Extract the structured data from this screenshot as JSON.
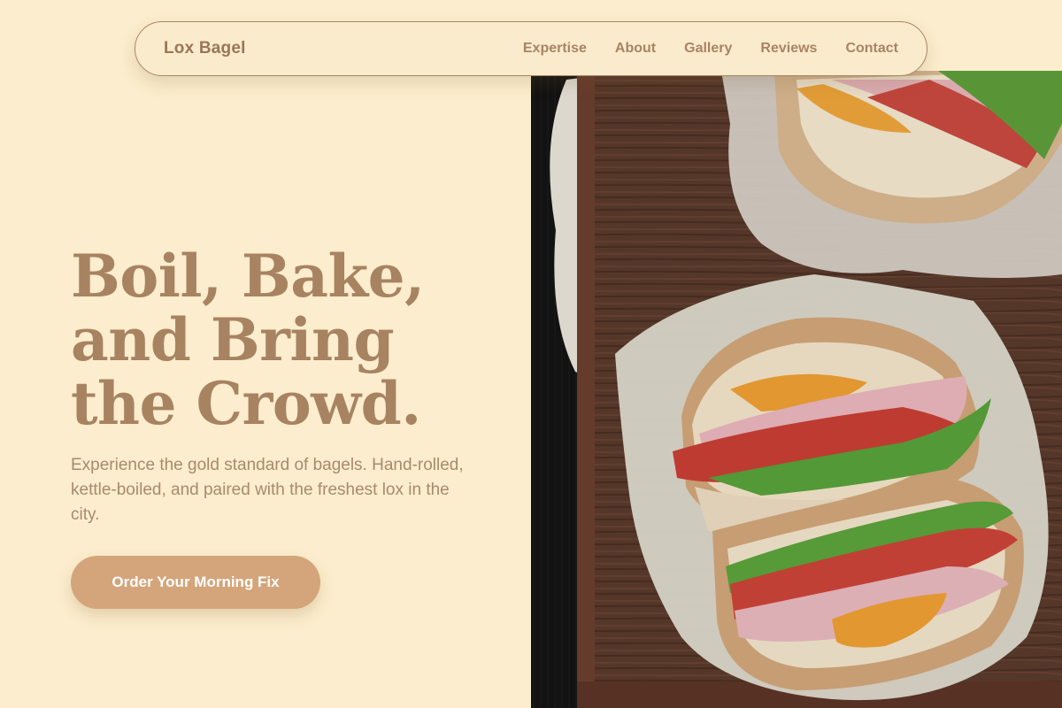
{
  "nav": {
    "brand": "Lox Bagel",
    "links": [
      {
        "label": "Expertise"
      },
      {
        "label": "About"
      },
      {
        "label": "Gallery"
      },
      {
        "label": "Reviews"
      },
      {
        "label": "Contact"
      }
    ]
  },
  "hero": {
    "headline_lines": [
      "Boil, Bake,",
      "and Bring",
      "the Crowd."
    ],
    "subtext": "Experience the gold standard of bagels. Hand-rolled, kettle-boiled, and paired with the freshest lox in the city.",
    "cta_label": "Order Your Morning Fix",
    "image_subject": "bagel-sandwich-photo"
  },
  "colors": {
    "page_bg": "#FBEDCD",
    "accent_text": "#A88361",
    "cta_bg": "#D4A57A",
    "cta_text": "#FFFFFF",
    "nav_border": "#A98563"
  }
}
